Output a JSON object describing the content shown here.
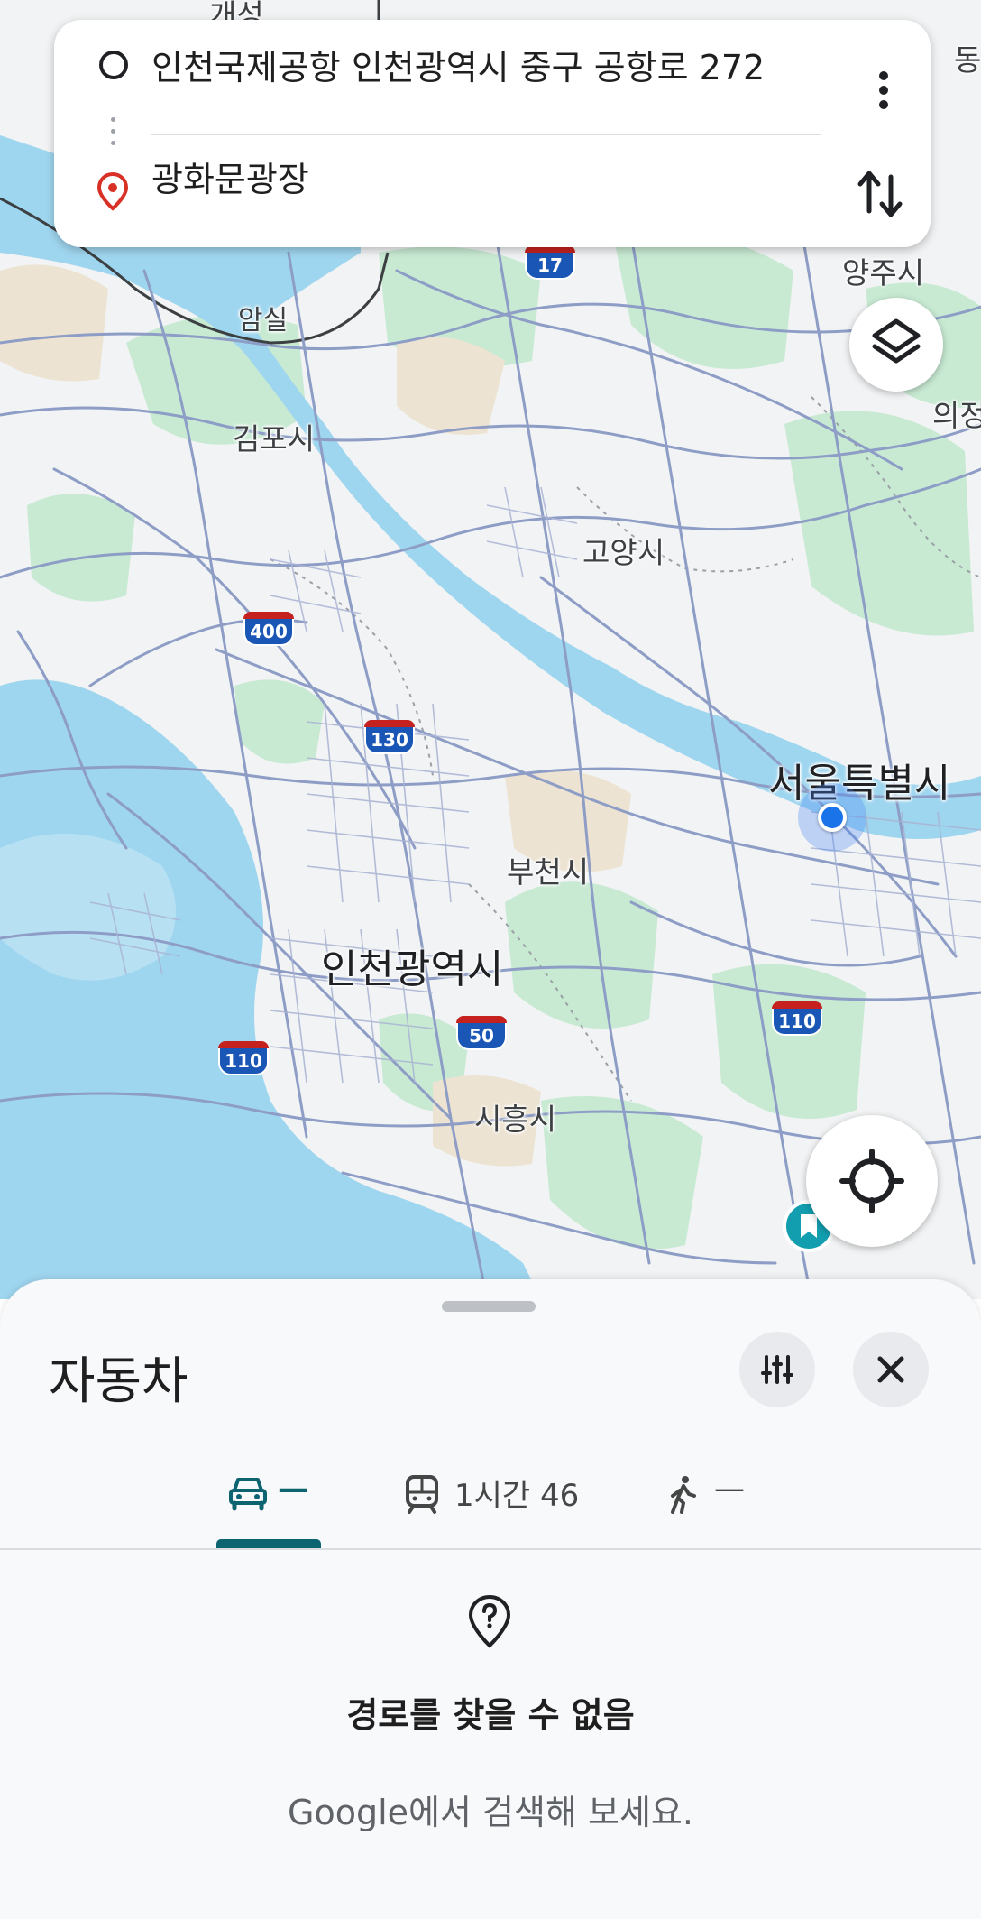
{
  "route": {
    "origin": "인천국제공항 인천광역시 중구 공항로 272",
    "destination": "광화문광장"
  },
  "map": {
    "labels": {
      "gaeseong": "개성",
      "dongducheon": "동",
      "amsil": "암실",
      "yangju": "양주시",
      "uijeongbu": "의정",
      "gimpo": "김포시",
      "goyang": "고양시",
      "seoul": "서울특별시",
      "bucheon": "부천시",
      "incheon": "인천광역시",
      "siheung": "시흥시"
    },
    "shields": {
      "s17": "17",
      "s400": "400",
      "s130": "130",
      "s50": "50",
      "s110a": "110",
      "s110b": "110"
    },
    "colors": {
      "water": "#9fd6ef",
      "park": "#c8ead3",
      "road": "#8d9dc6",
      "land": "#f1f3f4"
    }
  },
  "sheet": {
    "title": "자동차",
    "tabs": {
      "drive": "—",
      "transit": "1시간 46",
      "walk": "—"
    },
    "no_route": "경로를 찾을 수 없음",
    "hint": "Google에서 검색해 보세요."
  },
  "colors": {
    "accent": "#0b6470",
    "current_location": "#1a73e8",
    "pin": "#d93025"
  }
}
